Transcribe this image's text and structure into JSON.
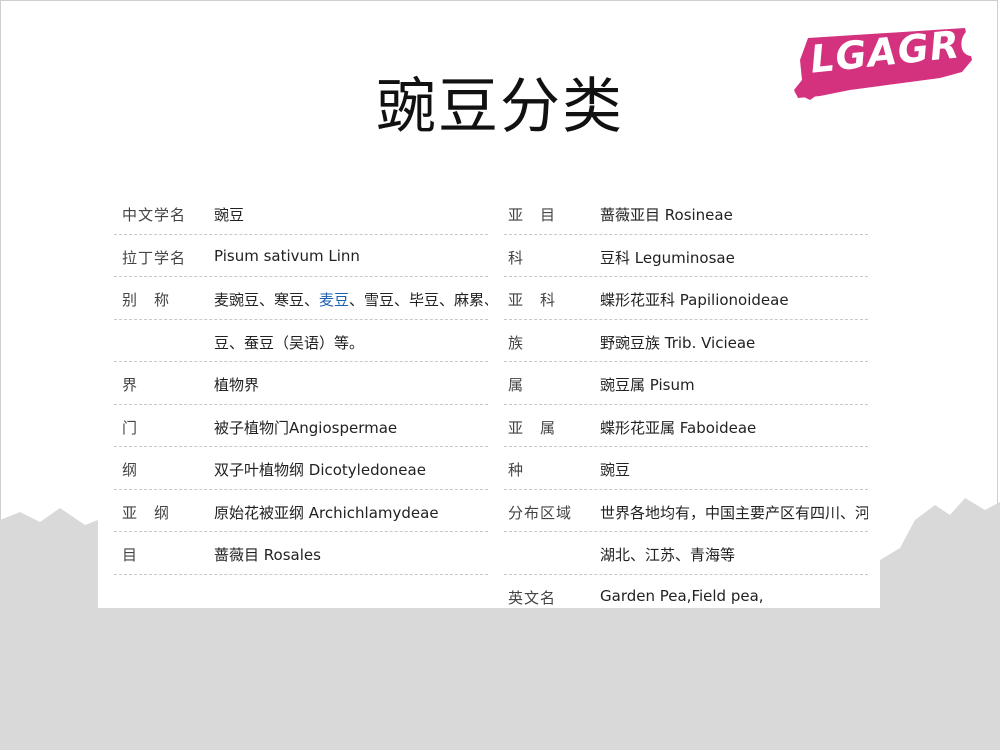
{
  "title": "豌豆分类",
  "logo": {
    "text": "LGAGRO",
    "color": "#d4327f"
  },
  "left_rows": [
    {
      "label": "中文学名",
      "value": "豌豆"
    },
    {
      "label": "拉丁学名",
      "value": "Pisum sativum Linn"
    },
    {
      "label": "别　称",
      "value_parts": [
        "麦豌豆、寒豆、",
        "麦豆",
        "、雪豆、毕豆、麻累、国"
      ]
    },
    {
      "label": "",
      "value": "豆、蚕豆（吴语）等。"
    },
    {
      "label": "界",
      "value": "植物界"
    },
    {
      "label": "门",
      "value": "被子植物门Angiospermae"
    },
    {
      "label": "纲",
      "value": "双子叶植物纲 Dicotyledoneae"
    },
    {
      "label": "亚　纲",
      "value": "原始花被亚纲 Archichlamydeae"
    },
    {
      "label": "目",
      "value": "蔷薇目 Rosales"
    },
    {
      "label": "",
      "value": ""
    }
  ],
  "right_rows": [
    {
      "label": "亚　目",
      "value": "蔷薇亚目 Rosineae"
    },
    {
      "label": "科",
      "value": "豆科 Leguminosae"
    },
    {
      "label": "亚　科",
      "value": "蝶形花亚科 Papilionoideae"
    },
    {
      "label": "族",
      "value": "野豌豆族 Trib. Vicieae"
    },
    {
      "label": "属",
      "value": "豌豆属 Pisum"
    },
    {
      "label": "亚　属",
      "value": "蝶形花亚属 Faboideae"
    },
    {
      "label": "种",
      "value": "豌豆"
    },
    {
      "label": "分布区域",
      "value": "世界各地均有，中国主要产区有四川、河南、"
    },
    {
      "label": "",
      "value": "湖北、江苏、青海等"
    },
    {
      "label": "英文名",
      "value": "Garden Pea,Field pea,"
    }
  ]
}
